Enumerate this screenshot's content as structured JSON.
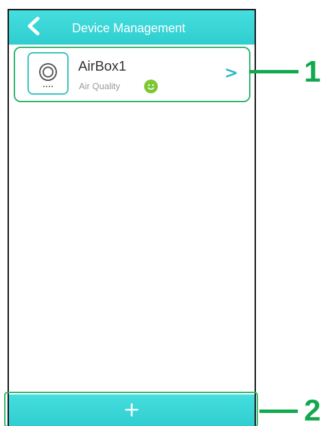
{
  "header": {
    "title": "Device Management",
    "back_icon": "back-chevron-icon"
  },
  "devices": [
    {
      "name": "AirBox1",
      "status_label": "Air Quality",
      "status_icon": "smiley-icon",
      "status_color": "#7cc733",
      "chevron": ">"
    }
  ],
  "footer": {
    "add_icon": "+"
  },
  "callouts": [
    {
      "number": "1"
    },
    {
      "number": "2"
    }
  ],
  "colors": {
    "accent": "#35d2d4",
    "highlight": "#2fb36a",
    "callout": "#11a84e"
  }
}
